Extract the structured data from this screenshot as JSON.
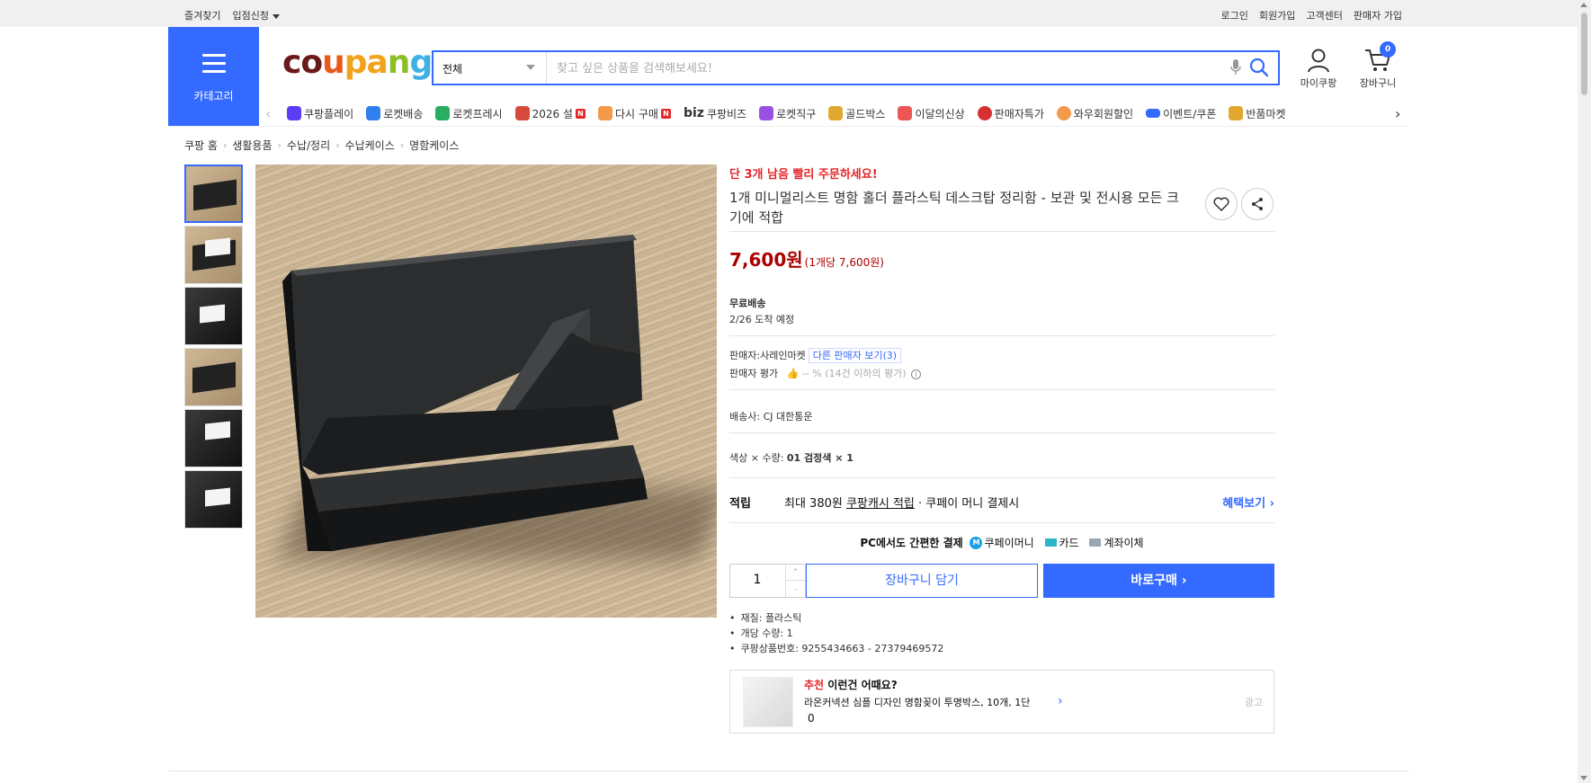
{
  "topbar": {
    "left": [
      "즐겨찾기",
      "입점신청"
    ],
    "right": [
      "로그인",
      "회원가입",
      "고객센터",
      "판매자 가입"
    ]
  },
  "header": {
    "category_label": "카테고리",
    "logo": [
      "c",
      "o",
      "u",
      "p",
      "a",
      "n",
      "g"
    ],
    "search_category": "전체",
    "search_placeholder": "찾고 싶은 상품을 검색해보세요!",
    "mypage_label": "마이쿠팡",
    "cart_label": "장바구니",
    "cart_count": "0"
  },
  "catnav": [
    {
      "label": "쿠팡플레이",
      "color": "#5b3df5",
      "new": false
    },
    {
      "label": "로켓배송",
      "color": "#2f80ed",
      "new": false
    },
    {
      "label": "로켓프레시",
      "color": "#27ae60",
      "new": false
    },
    {
      "label": "2026 설",
      "color": "#d64a3c",
      "new": true
    },
    {
      "label": "다시 구매",
      "color": "#f2994a",
      "new": true
    },
    {
      "label": "쿠팡비즈",
      "prefix": "biz",
      "color": "#333333",
      "new": false
    },
    {
      "label": "로켓직구",
      "color": "#9b51e0",
      "new": false
    },
    {
      "label": "골드박스",
      "color": "#e0a82e",
      "new": false
    },
    {
      "label": "이달의신상",
      "color": "#eb5757",
      "new": false
    },
    {
      "label": "판매자특가",
      "color": "#d63031",
      "new": false
    },
    {
      "label": "와우회원할인",
      "color": "#f2994a",
      "new": false
    },
    {
      "label": "이벤트/쿠폰",
      "color": "#346aff",
      "new": false
    },
    {
      "label": "반품마켓",
      "color": "#e0a82e",
      "new": false
    }
  ],
  "breadcrumb": [
    "쿠팡 홈",
    "생활용품",
    "수납/정리",
    "수납케이스",
    "명함케이스"
  ],
  "product": {
    "urgency": "단 3개 남음 빨리 주문하세요!",
    "title": "1개 미니멀리스트 명함 홀더 플라스틱 데스크탑 정리함 - 보관 및 전시용 모든 크기에 적합",
    "price": "7,600원",
    "unit_price": "(1개당 7,600원)",
    "shipping": "무료배송",
    "arrival": "2/26 도착 예정",
    "seller_label": "판매자:",
    "seller_name": "사레인마켓",
    "other_sellers": "다른 판매자 보기(3)",
    "seller_rating_label": "판매자 평가",
    "seller_rating_value": "-- %",
    "seller_rating_note": "(14건 이하의 평가)",
    "carrier_label": "배송사:",
    "carrier": "CJ 대한통운",
    "option_label": "색상 × 수량:",
    "option_value": "01 검정색 × 1",
    "reward_label": "적립",
    "reward_prefix": "최대 380원",
    "reward_link": "쿠팡캐시 적립",
    "reward_suffix": "· 쿠페이 머니 결제시",
    "reward_more": "혜택보기",
    "pay_title": "PC에서도 간편한 결제",
    "pay_methods": [
      "쿠페이머니",
      "카드",
      "계좌이체"
    ],
    "quantity": "1",
    "cart_button": "장바구니 담기",
    "buy_button": "바로구매",
    "specs": [
      "재질: 플라스틱",
      "개당 수량: 1",
      "쿠팡상품번호: 9255434663 - 27379469572"
    ]
  },
  "recommend": {
    "tag": "추천",
    "title": "이런건 어때요?",
    "item": "라온커넥션 심플 디자인 명함꽂이 투명박스, 10개, 1단",
    "extra": "0",
    "ad": "광고"
  },
  "colors": {
    "accent": "#346aff",
    "price": "#ae0000",
    "urgent": "#e52528"
  }
}
